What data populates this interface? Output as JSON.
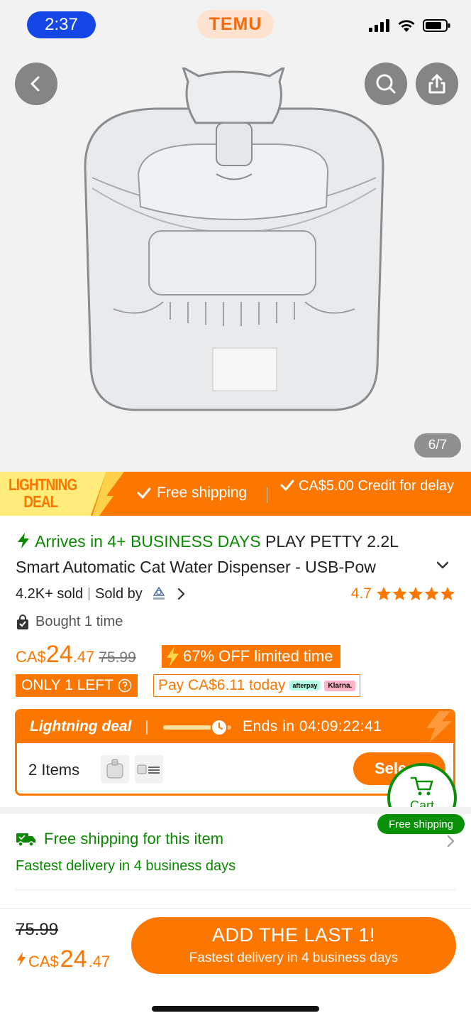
{
  "status_bar": {
    "time": "2:37"
  },
  "header": {
    "logo": "TEMU"
  },
  "gallery": {
    "counter": "6/7"
  },
  "deal_banner": {
    "badge_line1": "LIGHTNING",
    "badge_line2": "DEAL",
    "free_shipping": "Free shipping",
    "credit": "CA$5.00 Credit for delay"
  },
  "product": {
    "arrives": "Arrives in 4+ BUSINESS DAYS",
    "title": "PLAY PETTY 2.2L Smart Automatic Cat Water Dispenser - USB-Pow",
    "sold": "4.2K+ sold",
    "sold_by": "Sold by",
    "rating": "4.7",
    "bought": "Bought 1 time"
  },
  "price": {
    "currency": "CA$",
    "whole": "24",
    "cents": ".47",
    "original": "75.99",
    "discount": "67% OFF limited time",
    "only_left": "ONLY 1 LEFT",
    "pay_today": "Pay CA$6.11 today",
    "afterpay": "afterpay",
    "klarna": "Klarna."
  },
  "lightning_deal": {
    "title": "Lightning deal",
    "ends": "Ends in 04:09:22:41",
    "progress": 0.7,
    "items": "2 Items",
    "select": "Sele"
  },
  "cart_float": {
    "label": "Cart",
    "free_shipping": "Free shipping"
  },
  "shipping": {
    "title": "Free shipping for this item",
    "subtitle": "Fastest delivery in 4 business days"
  },
  "bottom_bar": {
    "original": "75.99",
    "currency": "CA$",
    "whole": "24",
    "cents": ".47",
    "cta": "ADD THE LAST 1!",
    "cta_sub": "Fastest delivery in 4 business days"
  },
  "colors": {
    "accent": "#fb7701",
    "green": "#0a8800",
    "blue": "#1447e6"
  }
}
